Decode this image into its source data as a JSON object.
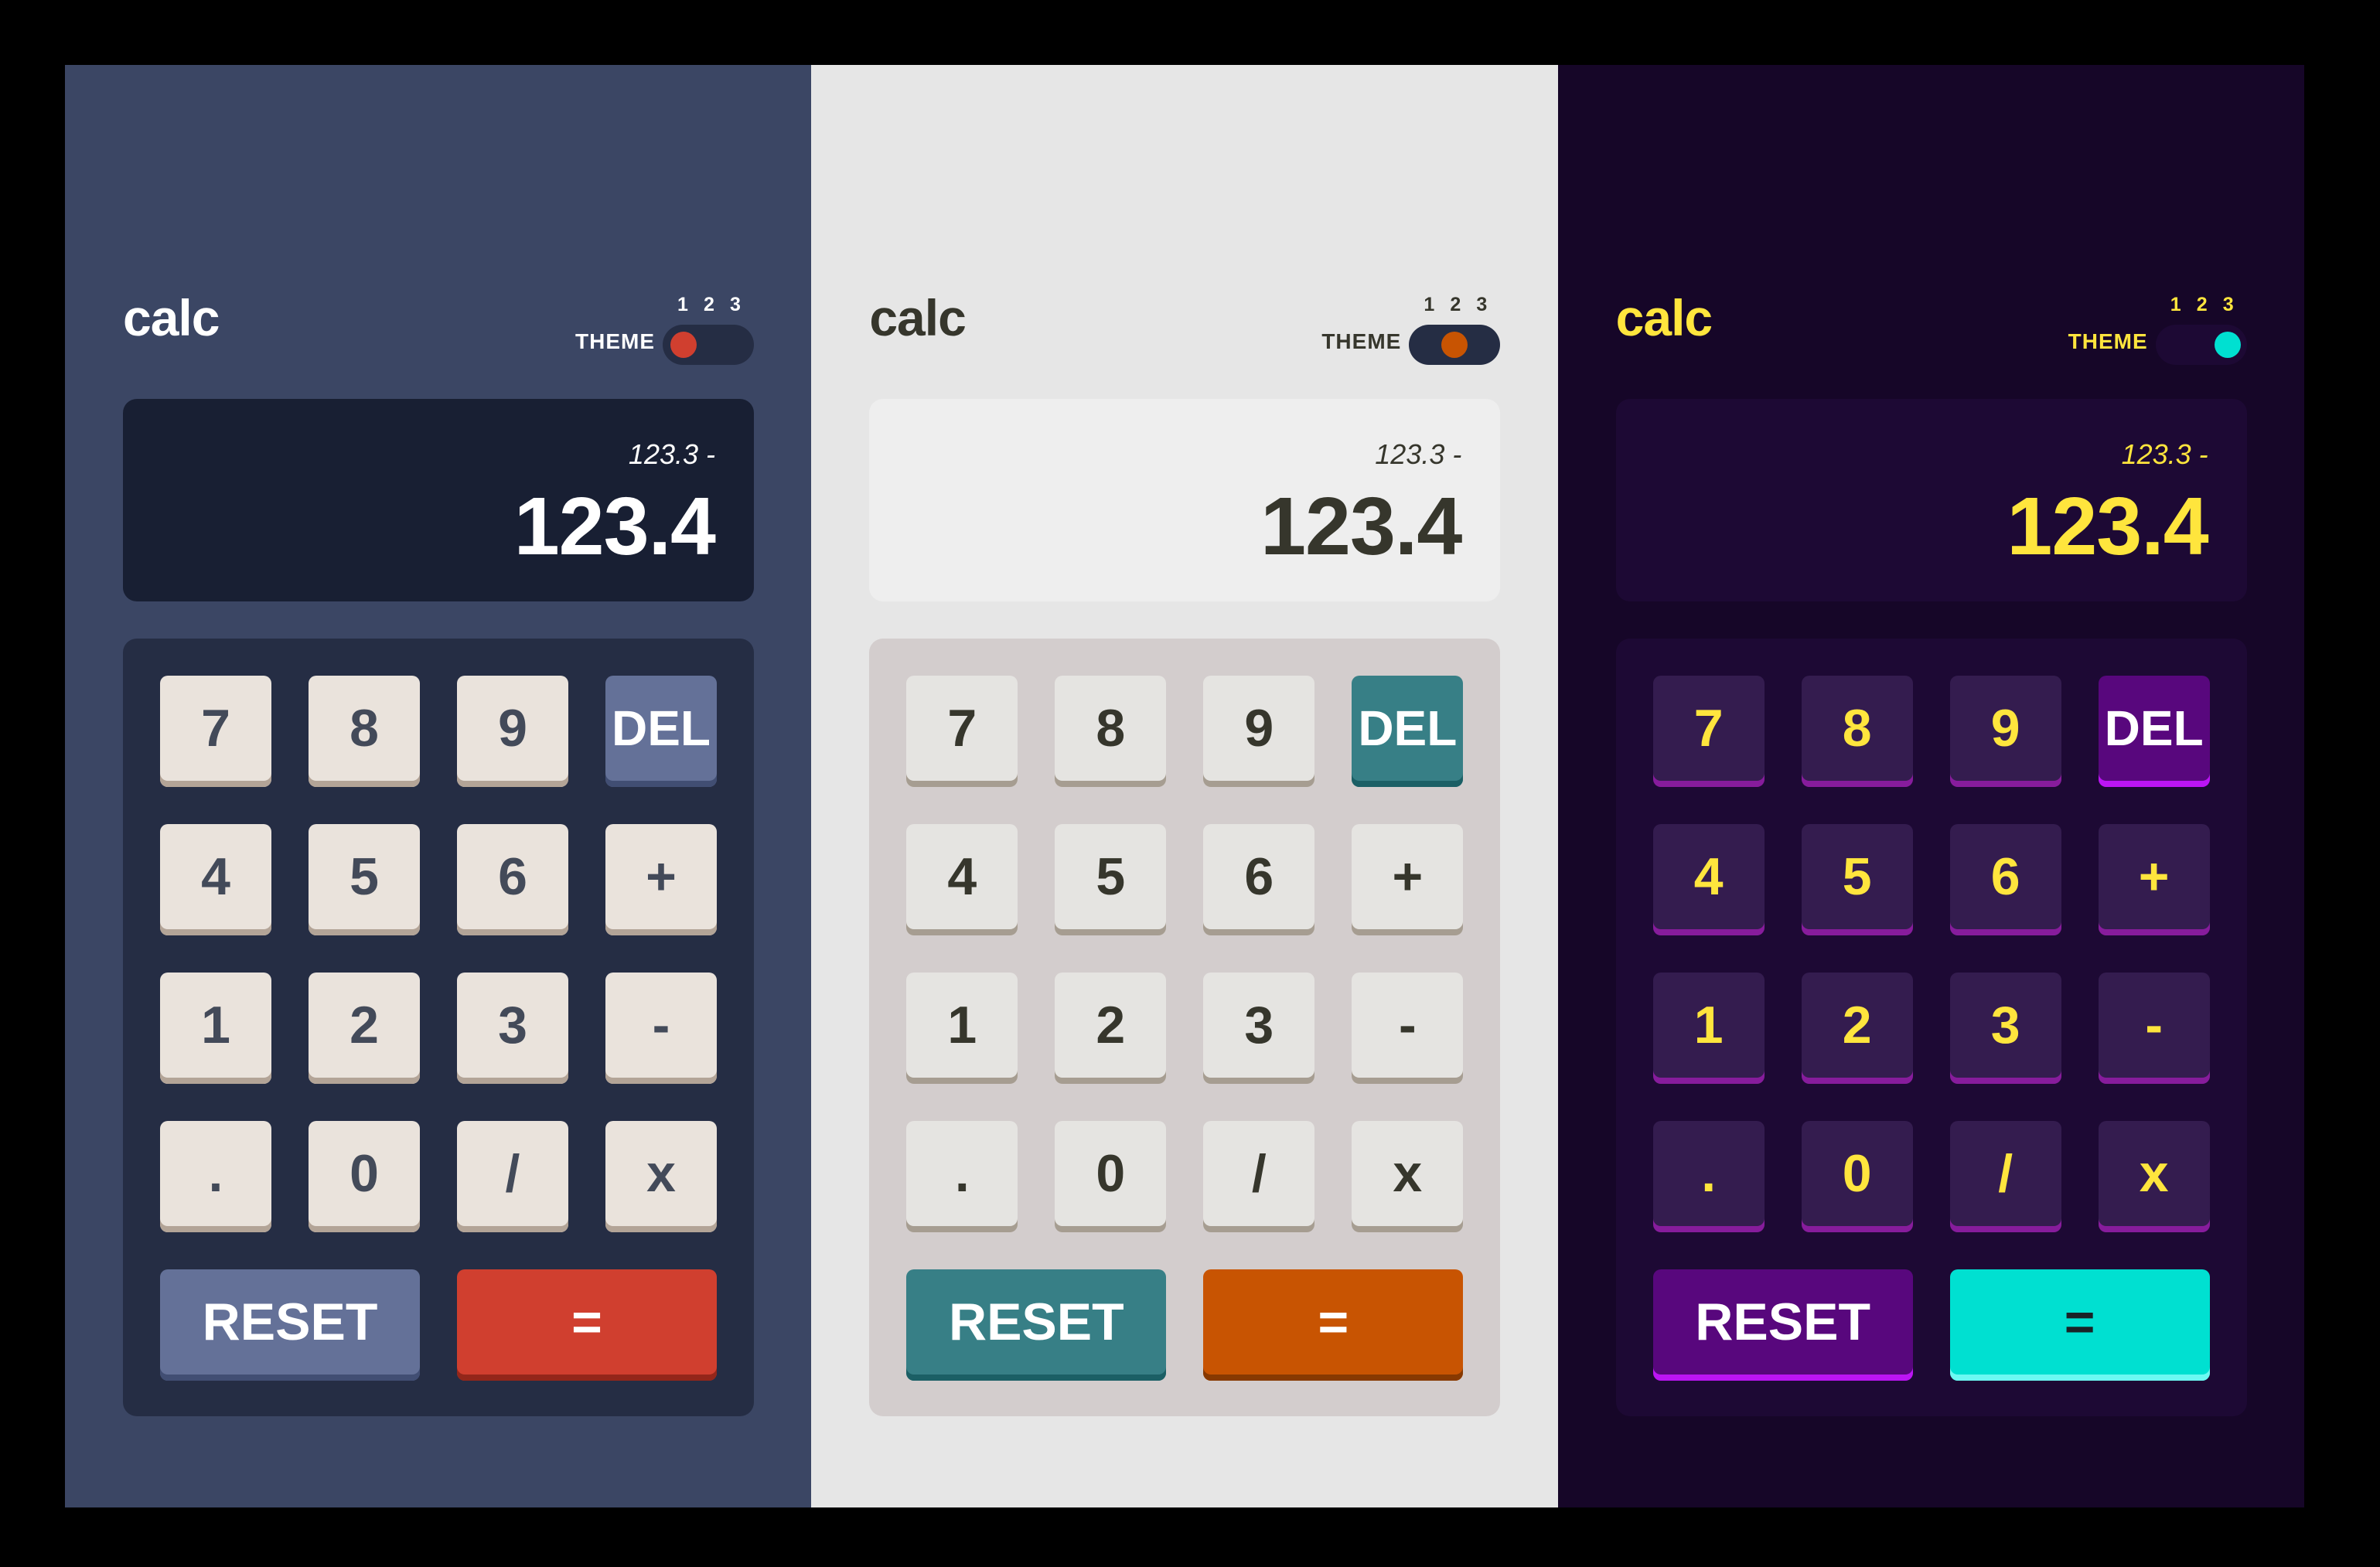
{
  "panels": [
    {
      "theme_id": "theme-1",
      "logo": "calc",
      "theme_label": "THEME",
      "theme_options": [
        "1",
        "2",
        "3"
      ],
      "selected_theme": "1",
      "display": {
        "previous": "123.3 -",
        "current": "123.4"
      },
      "keys": [
        "7",
        "8",
        "9",
        "DEL",
        "4",
        "5",
        "6",
        "+",
        "1",
        "2",
        "3",
        "-",
        ".",
        "0",
        "/",
        "x"
      ],
      "reset_label": "RESET",
      "equals_label": "=",
      "colors": {
        "background": "#3b4664",
        "keypad": "#252d44",
        "screen": "#181f33",
        "key": "#eae3dc",
        "accent": "#647198",
        "equals": "#d03f2f",
        "text": "#ffffff"
      }
    },
    {
      "theme_id": "theme-2",
      "logo": "calc",
      "theme_label": "THEME",
      "theme_options": [
        "1",
        "2",
        "3"
      ],
      "selected_theme": "2",
      "display": {
        "previous": "123.3 -",
        "current": "123.4"
      },
      "keys": [
        "7",
        "8",
        "9",
        "DEL",
        "4",
        "5",
        "6",
        "+",
        "1",
        "2",
        "3",
        "-",
        ".",
        "0",
        "/",
        "x"
      ],
      "reset_label": "RESET",
      "equals_label": "=",
      "colors": {
        "background": "#e6e6e6",
        "keypad": "#d3cdcd",
        "screen": "#eeeeee",
        "key": "#e5e4e1",
        "accent": "#377f86",
        "equals": "#c85402",
        "text": "#36362c"
      }
    },
    {
      "theme_id": "theme-3",
      "logo": "calc",
      "theme_label": "THEME",
      "theme_options": [
        "1",
        "2",
        "3"
      ],
      "selected_theme": "3",
      "display": {
        "previous": "123.3 -",
        "current": "123.4"
      },
      "keys": [
        "7",
        "8",
        "9",
        "DEL",
        "4",
        "5",
        "6",
        "+",
        "1",
        "2",
        "3",
        "-",
        ".",
        "0",
        "/",
        "x"
      ],
      "reset_label": "RESET",
      "equals_label": "=",
      "colors": {
        "background": "#160628",
        "keypad": "#1d0934",
        "screen": "#1d0934",
        "key": "#341c4f",
        "accent": "#58077d",
        "equals": "#00e0d1",
        "text": "#ffe53d"
      }
    }
  ]
}
